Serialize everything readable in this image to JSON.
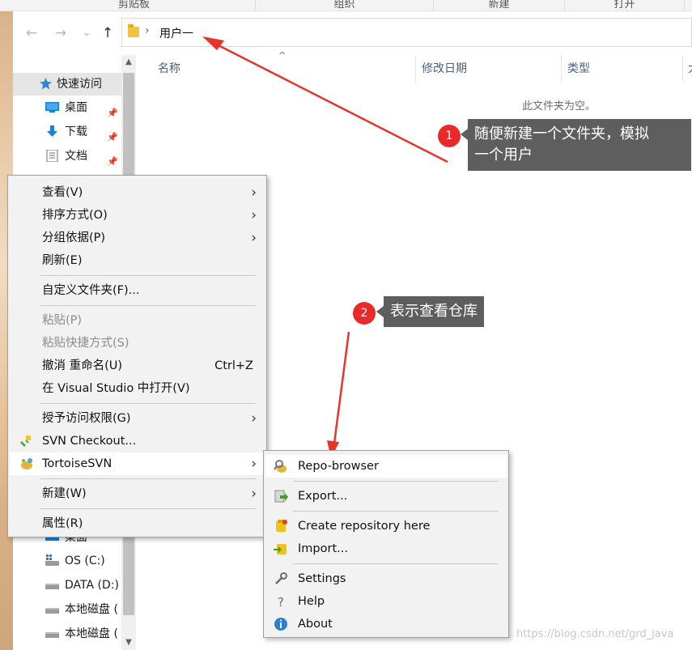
{
  "ribbon": {
    "groups": [
      "剪贴板",
      "组织",
      "新建",
      "打开"
    ]
  },
  "address": {
    "breadcrumb_sep": "›",
    "current_folder": "用户一"
  },
  "nav_buttons": {
    "back": "←",
    "forward": "→",
    "recent": "⌄",
    "up": "↑"
  },
  "navpane": {
    "items": [
      {
        "label": "快速访问",
        "icon": "star-icon"
      },
      {
        "label": "桌面",
        "icon": "desktop-icon",
        "pinned": true
      },
      {
        "label": "下载",
        "icon": "download-icon",
        "pinned": true
      },
      {
        "label": "文档",
        "icon": "document-icon",
        "pinned": true
      }
    ],
    "lower_items": [
      {
        "label": "桌面",
        "icon": "desktop-icon"
      },
      {
        "label": "OS (C:)",
        "icon": "windows-drive-icon"
      },
      {
        "label": "DATA (D:)",
        "icon": "drive-icon"
      },
      {
        "label": "本地磁盘 (",
        "icon": "drive-icon"
      },
      {
        "label": "本地磁盘 (",
        "icon": "drive-icon"
      }
    ]
  },
  "columns": [
    "名称",
    "修改日期",
    "类型",
    "大"
  ],
  "content": {
    "empty_message": "此文件夹为空。"
  },
  "callouts": [
    {
      "number": "1",
      "text_line1": "随便新建一个文件夹，模拟",
      "text_line2": "一个用户"
    },
    {
      "number": "2",
      "text_line1": "表示查看仓库"
    }
  ],
  "context_menu": {
    "items": [
      {
        "label": "查看(V)",
        "submenu": true
      },
      {
        "label": "排序方式(O)",
        "submenu": true
      },
      {
        "label": "分组依据(P)",
        "submenu": true
      },
      {
        "label": "刷新(E)"
      },
      {
        "label": "自定义文件夹(F)..."
      },
      {
        "label": "粘贴(P)",
        "disabled": true
      },
      {
        "label": "粘贴快捷方式(S)",
        "disabled": true
      },
      {
        "label": "撤消 重命名(U)",
        "shortcut": "Ctrl+Z"
      },
      {
        "label": "在 Visual Studio 中打开(V)"
      },
      {
        "label": "授予访问权限(G)",
        "submenu": true
      },
      {
        "label": "SVN Checkout...",
        "icon": "svn-checkout-icon"
      },
      {
        "label": "TortoiseSVN",
        "icon": "tortoisesvn-icon",
        "submenu": true,
        "highlighted": true
      },
      {
        "label": "新建(W)",
        "submenu": true
      },
      {
        "label": "属性(R)"
      }
    ]
  },
  "submenu": {
    "items": [
      {
        "label": "Repo-browser",
        "icon": "repo-browser-icon",
        "highlighted": true
      },
      {
        "label": "Export...",
        "icon": "export-icon"
      },
      {
        "label": "Create repository here",
        "icon": "create-repo-icon"
      },
      {
        "label": "Import...",
        "icon": "import-icon"
      },
      {
        "label": "Settings",
        "icon": "wrench-icon"
      },
      {
        "label": "Help",
        "icon": "help-icon"
      },
      {
        "label": "About",
        "icon": "info-icon"
      }
    ]
  },
  "watermark": "https://blog.csdn.net/grd_java",
  "colors": {
    "callout_red": "#ea2a2a",
    "callout_bg": "#5e5e5e",
    "arrow_red": "#e8332b",
    "header_text": "#4c607a"
  }
}
